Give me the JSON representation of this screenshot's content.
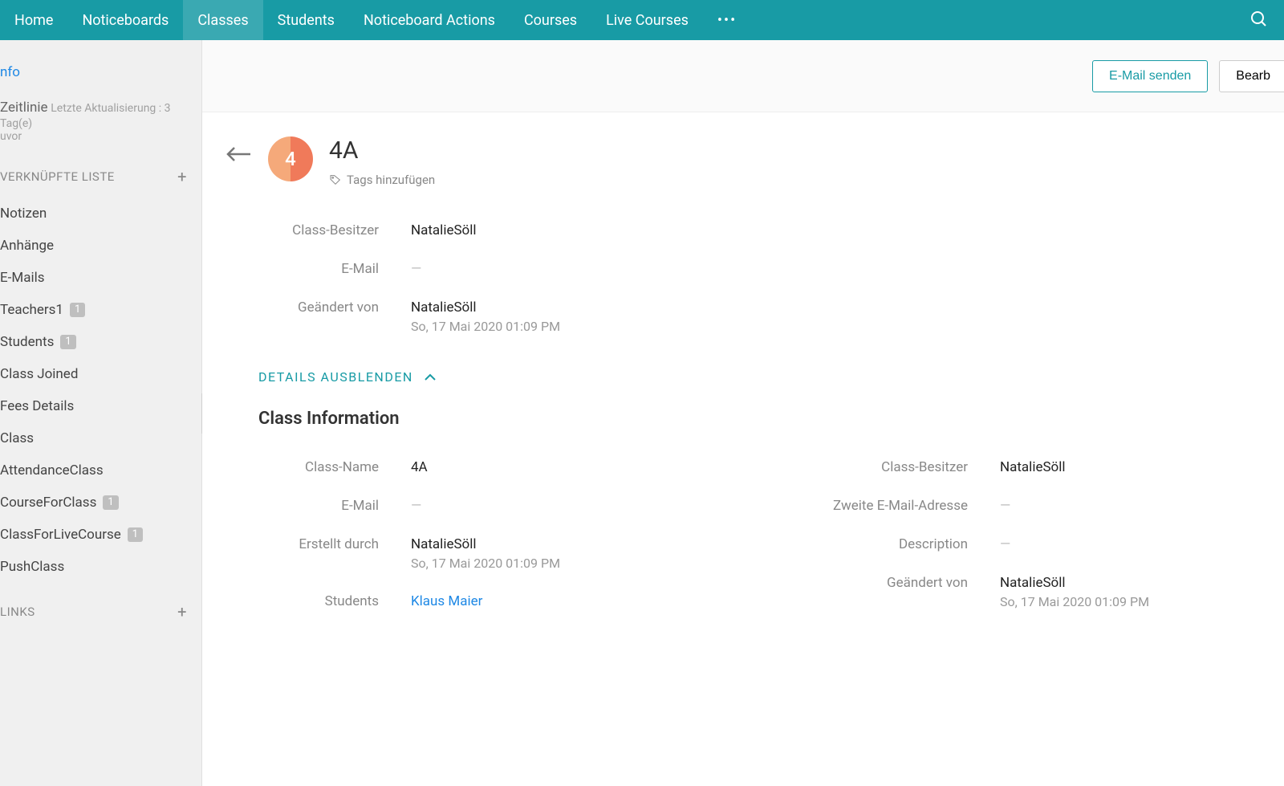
{
  "topnav": {
    "items": [
      "Home",
      "Noticeboards",
      "Classes",
      "Students",
      "Noticeboard Actions",
      "Courses",
      "Live Courses"
    ],
    "active_index": 2
  },
  "actions": {
    "send_email": "E-Mail senden",
    "edit": "Bearb"
  },
  "sidebar": {
    "info_link": "nfo",
    "timeline_label": "Zeitlinie",
    "timeline_sub1": "Letzte Aktualisierung : 3 Tag(e)",
    "timeline_sub2": "uvor",
    "linked_heading": "VERKNÜPFTE LISTE",
    "items": [
      {
        "label": "Notizen"
      },
      {
        "label": "Anhänge"
      },
      {
        "label": "E-Mails"
      },
      {
        "label": "Teachers1",
        "badge": "1"
      },
      {
        "label": "Students",
        "badge": "1"
      },
      {
        "label": "Class Joined"
      },
      {
        "label": "Fees Details"
      },
      {
        "label": "Class"
      },
      {
        "label": "AttendanceClass"
      },
      {
        "label": "CourseForClass",
        "badge": "1"
      },
      {
        "label": "ClassForLiveCourse",
        "badge": "1"
      },
      {
        "label": "PushClass"
      }
    ],
    "links_heading": "LINKS"
  },
  "record": {
    "avatar_text": "4",
    "title": "4A",
    "add_tags": "Tags hinzufügen",
    "summary_fields": [
      {
        "label": "Class-Besitzer",
        "value": "NatalieSöll"
      },
      {
        "label": "E-Mail",
        "value": "—",
        "dash": true
      },
      {
        "label": "Geändert von",
        "value": "NatalieSöll",
        "sub": "So, 17 Mai 2020 01:09 PM"
      }
    ],
    "details_toggle": "DETAILS AUSBLENDEN",
    "section_title": "Class Information",
    "left_fields": [
      {
        "label": "Class-Name",
        "value": "4A"
      },
      {
        "label": "E-Mail",
        "value": "—",
        "dash": true
      },
      {
        "label": "Erstellt durch",
        "value": "NatalieSöll",
        "sub": "So, 17 Mai 2020 01:09 PM"
      },
      {
        "label": "Students",
        "value": "Klaus Maier",
        "link": true
      }
    ],
    "right_fields": [
      {
        "label": "Class-Besitzer",
        "value": "NatalieSöll"
      },
      {
        "label": "Zweite E-Mail-Adresse",
        "value": "—",
        "dash": true
      },
      {
        "label": "Description",
        "value": "—",
        "dash": true
      },
      {
        "label": "Geändert von",
        "value": "NatalieSöll",
        "sub": "So, 17 Mai 2020 01:09 PM"
      }
    ]
  }
}
